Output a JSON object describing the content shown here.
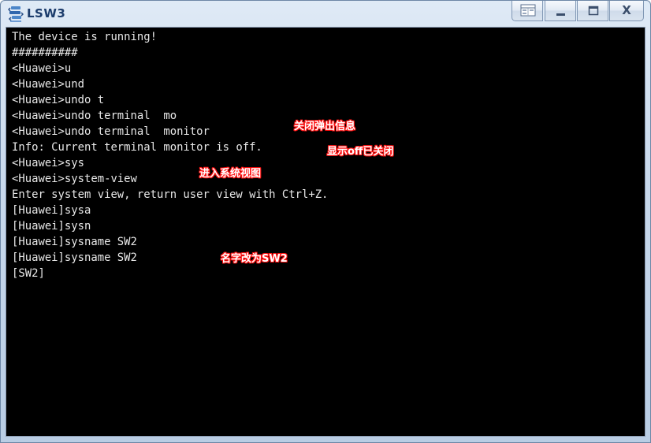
{
  "window": {
    "title": "LSW3",
    "close_label": "X"
  },
  "icons": {
    "app": "switch-app-icon",
    "restore": "restore-layout-icon",
    "minimize": "minimize-icon",
    "maximize": "maximize-icon",
    "close": "close-icon"
  },
  "terminal": {
    "lines": [
      "The device is running!",
      "##########",
      "<Huawei>u",
      "<Huawei>und",
      "<Huawei>undo t",
      "<Huawei>undo terminal  mo",
      "<Huawei>undo terminal  monitor",
      "Info: Current terminal monitor is off.",
      "<Huawei>sys",
      "<Huawei>system-view",
      "Enter system view, return user view with Ctrl+Z.",
      "[Huawei]sysa",
      "[Huawei]sysn",
      "[Huawei]sysname SW2",
      "[Huawei]sysname SW2",
      "[SW2]"
    ]
  },
  "annotations": {
    "close_popup": "关闭弹出信息",
    "off_closed": "显示off已关闭",
    "enter_system_view": "进入系统视图",
    "rename": "名字改为SW2"
  },
  "colors": {
    "terminal_bg": "#000000",
    "terminal_text": "#e8e8e8",
    "annotation_outline": "#ff1010",
    "title_text": "#1c3c6c"
  }
}
